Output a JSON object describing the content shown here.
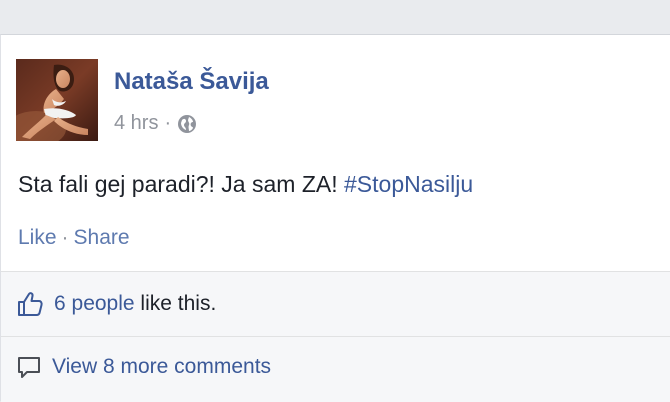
{
  "post": {
    "author": "Nataša Šavija",
    "time": "4 hrs",
    "meta_sep": "·",
    "privacy_icon": "globe-icon",
    "text_before": "Sta fali gej paradi?! Ja sam ZA!",
    "hashtag": "#StopNasilju",
    "actions": {
      "like": "Like",
      "sep": "·",
      "share": "Share"
    }
  },
  "ufi": {
    "like_icon": "thumbs-up-icon",
    "likes_count": "6 people",
    "likes_suffix": "like this.",
    "comment_icon": "comment-bubble-icon",
    "view_comments": "View 8 more comments"
  },
  "colors": {
    "link": "#3b5998",
    "muted": "#90949c",
    "text": "#1d2129",
    "background": "#e9ebee",
    "ufi_background": "#f6f7f9"
  }
}
